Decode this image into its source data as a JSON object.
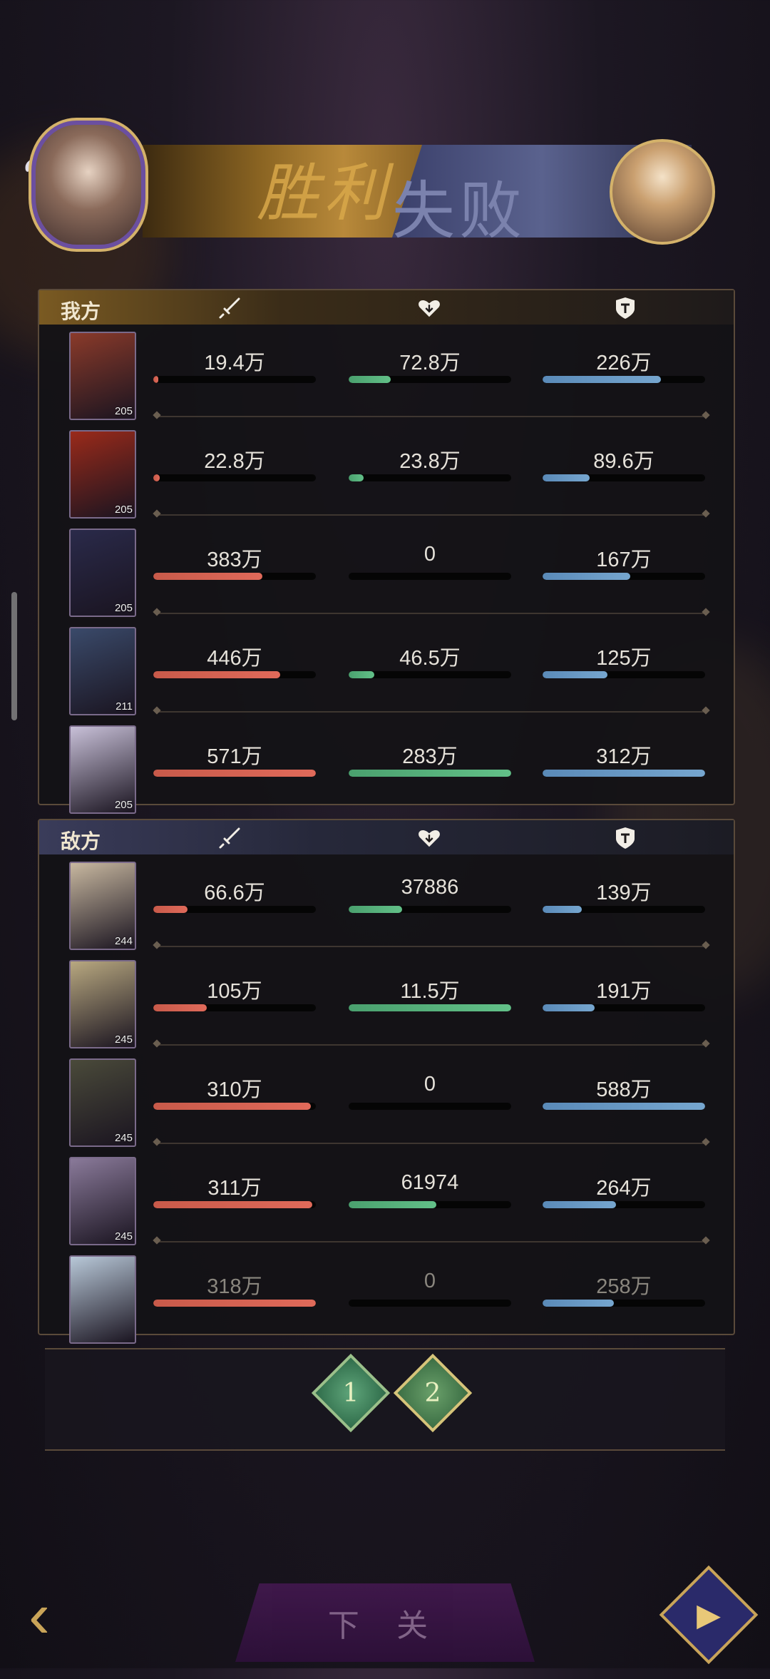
{
  "banner": {
    "win_label": "胜利",
    "lose_label": "失败"
  },
  "my_panel": {
    "title": "我方",
    "icons": {
      "attack": "sword-icon",
      "heal": "heart-icon",
      "defense": "shield-icon"
    },
    "rows": [
      {
        "level": "205",
        "attack": "19.4万",
        "attack_pct": 3,
        "heal": "72.8万",
        "heal_pct": 26,
        "defense": "226万",
        "defense_pct": 73,
        "portrait_color": "#8a3a2a"
      },
      {
        "level": "205",
        "attack": "22.8万",
        "attack_pct": 4,
        "heal": "23.8万",
        "heal_pct": 9,
        "defense": "89.6万",
        "defense_pct": 29,
        "portrait_color": "#9a2a1a"
      },
      {
        "level": "205",
        "attack": "383万",
        "attack_pct": 67,
        "heal": "0",
        "heal_pct": 0,
        "defense": "167万",
        "defense_pct": 54,
        "portrait_color": "#2a2a4a"
      },
      {
        "level": "211",
        "attack": "446万",
        "attack_pct": 78,
        "heal": "46.5万",
        "heal_pct": 16,
        "defense": "125万",
        "defense_pct": 40,
        "portrait_color": "#3a4a6a"
      },
      {
        "level": "205",
        "attack": "571万",
        "attack_pct": 100,
        "heal": "283万",
        "heal_pct": 100,
        "defense": "312万",
        "defense_pct": 100,
        "portrait_color": "#c8c0d8"
      }
    ]
  },
  "enemy_panel": {
    "title": "敌方",
    "icons": {
      "attack": "sword-icon",
      "heal": "heart-icon",
      "defense": "shield-icon"
    },
    "rows": [
      {
        "level": "244",
        "attack": "66.6万",
        "attack_pct": 21,
        "heal": "37886",
        "heal_pct": 33,
        "defense": "139万",
        "defense_pct": 24,
        "portrait_color": "#c8b8a0"
      },
      {
        "level": "245",
        "attack": "105万",
        "attack_pct": 33,
        "heal": "11.5万",
        "heal_pct": 100,
        "defense": "191万",
        "defense_pct": 32,
        "portrait_color": "#b8a880"
      },
      {
        "level": "245",
        "attack": "310万",
        "attack_pct": 97,
        "heal": "0",
        "heal_pct": 0,
        "defense": "588万",
        "defense_pct": 100,
        "portrait_color": "#4a4a3a"
      },
      {
        "level": "245",
        "attack": "311万",
        "attack_pct": 98,
        "heal": "61974",
        "heal_pct": 54,
        "defense": "264万",
        "defense_pct": 45,
        "portrait_color": "#8a7a9a"
      },
      {
        "level": "",
        "attack": "318万",
        "attack_pct": 100,
        "heal": "0",
        "heal_pct": 0,
        "defense": "258万",
        "defense_pct": 44,
        "portrait_color": "#b8c8d8"
      }
    ]
  },
  "rounds": {
    "round_1": "1",
    "round_2": "2",
    "selected": "2"
  },
  "bottom": {
    "back_icon": "back-arrow-icon",
    "confirm_label": "下 关",
    "replay_icon": "replay-icon"
  }
}
